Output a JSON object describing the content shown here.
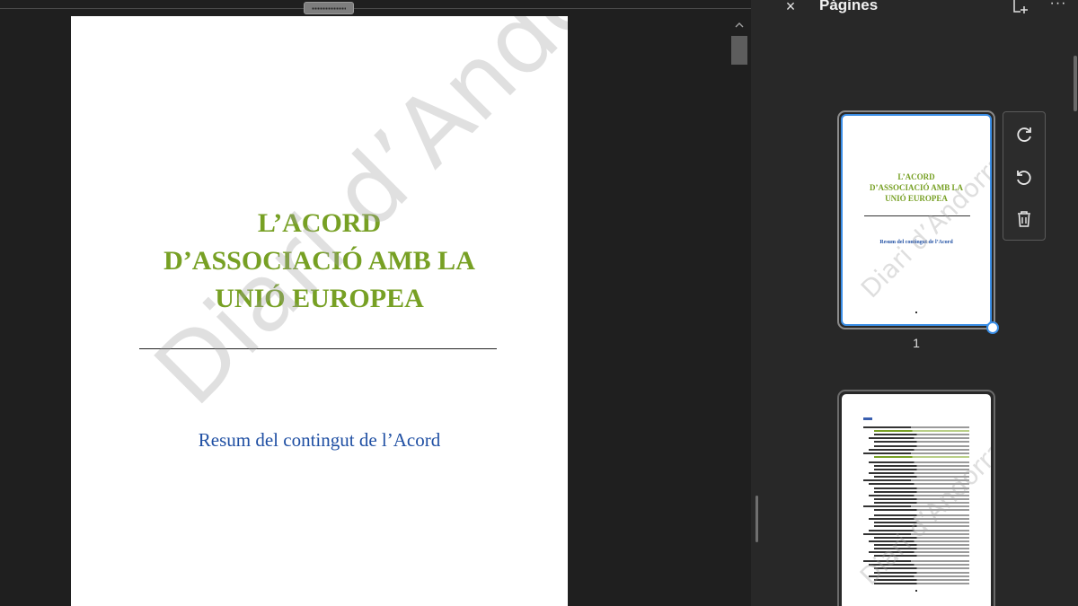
{
  "document": {
    "title_lines": [
      "L’ACORD",
      "D’ASSOCIACIÓ AMB LA",
      "UNIÓ EUROPEA"
    ],
    "subtitle": "Resum del contingut de l’Acord",
    "watermark": "Diari d’Andorra",
    "colors": {
      "title": "#77a024",
      "subtitle": "#1f4fa3",
      "page": "#ffffff"
    }
  },
  "viewer": {
    "scroll_up_icon": "chevron-up-icon",
    "resize_grip_icon": "grip-icon"
  },
  "panel": {
    "title": "Pàgines",
    "close_label": "×",
    "more_label": "···",
    "add_icon": "insert-page-icon",
    "tools": [
      {
        "name": "rotate-clockwise-icon"
      },
      {
        "name": "rotate-counterclockwise-icon"
      },
      {
        "name": "trash-icon"
      }
    ],
    "thumbnails": [
      {
        "page_number": "1",
        "selected": true,
        "title_lines": [
          "L’ACORD",
          "D’ASSOCIACIÓ AMB LA",
          "UNIÓ EUROPEA"
        ],
        "subtitle": "Resum del contingut de l’Acord",
        "watermark": "Diari d’Andorra"
      },
      {
        "selected": false,
        "watermark": "Diari d’Andorra"
      }
    ],
    "accent_color": "#3a8ee6"
  }
}
